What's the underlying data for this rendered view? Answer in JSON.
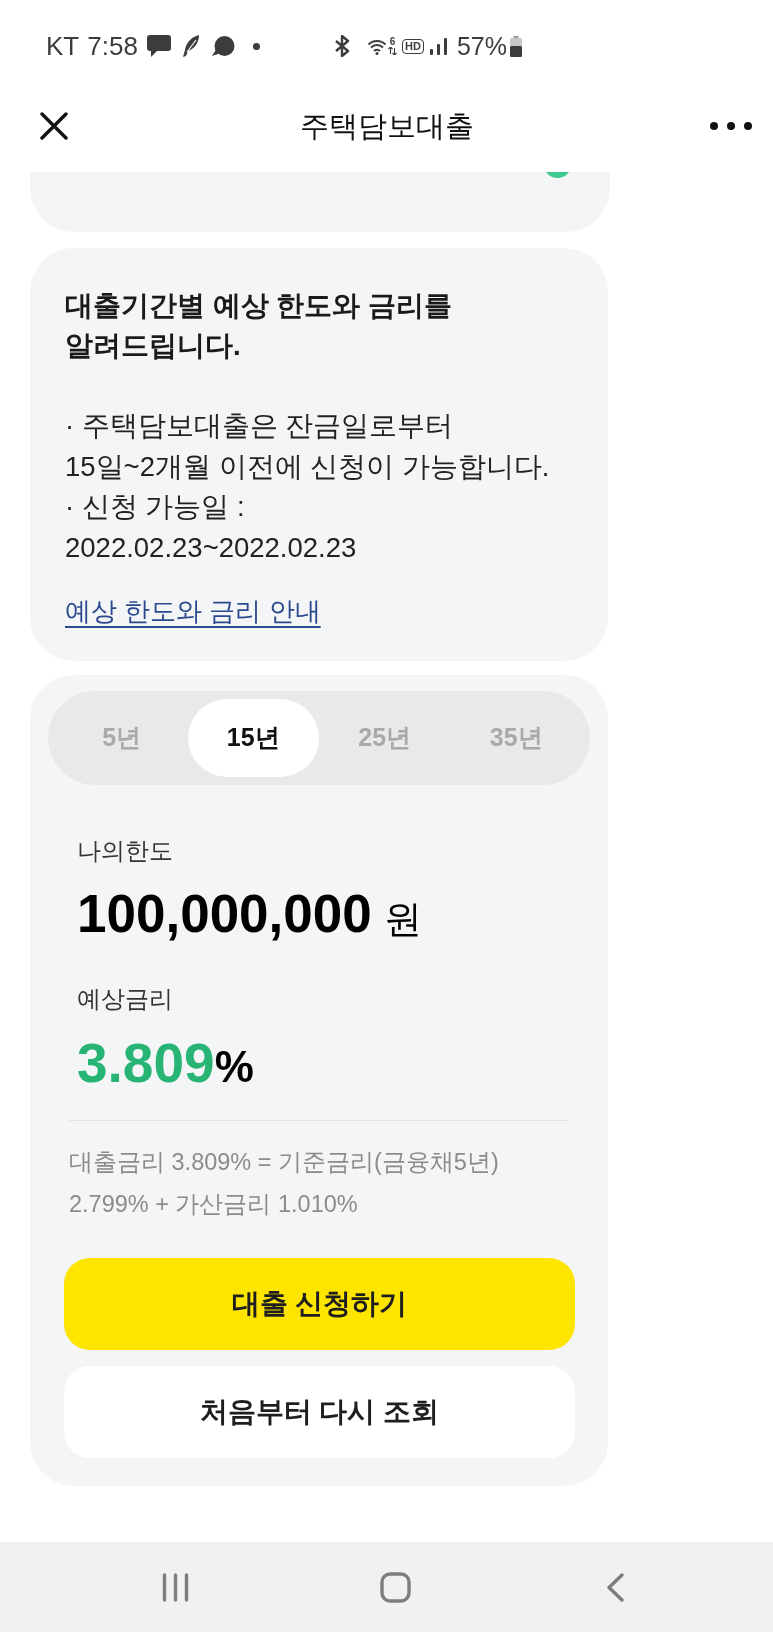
{
  "status_bar": {
    "carrier": "KT",
    "time": "7:58",
    "wifi_label": "6",
    "hd_label": "HD",
    "battery": "57%"
  },
  "header": {
    "title": "주택담보대출"
  },
  "info_card": {
    "heading": "대출기간별 예상 한도와 금리를\n알려드립니다.",
    "notes": [
      "· 주택담보대출은 잔금일로부터\n15일~2개월 이전에 신청이 가능합니다.",
      "· 신청 가능일 :\n2022.02.23~2022.02.23"
    ],
    "link": "예상 한도와 금리 안내"
  },
  "result_card": {
    "tabs": [
      {
        "label": "5년",
        "selected": false
      },
      {
        "label": "15년",
        "selected": true
      },
      {
        "label": "25년",
        "selected": false
      },
      {
        "label": "35년",
        "selected": false
      }
    ],
    "limit": {
      "label": "나의한도",
      "amount": "100,000,000",
      "unit": "원"
    },
    "rate": {
      "label": "예상금리",
      "value": "3.809",
      "unit": "%"
    },
    "formula": "대출금리 3.809% = 기준금리(금융채5년)\n2.799% + 가산금리 1.010%",
    "buttons": [
      {
        "label": "대출 신청하기",
        "kind": "primary"
      },
      {
        "label": "처음부터 다시 조회",
        "kind": "secondary"
      }
    ]
  }
}
